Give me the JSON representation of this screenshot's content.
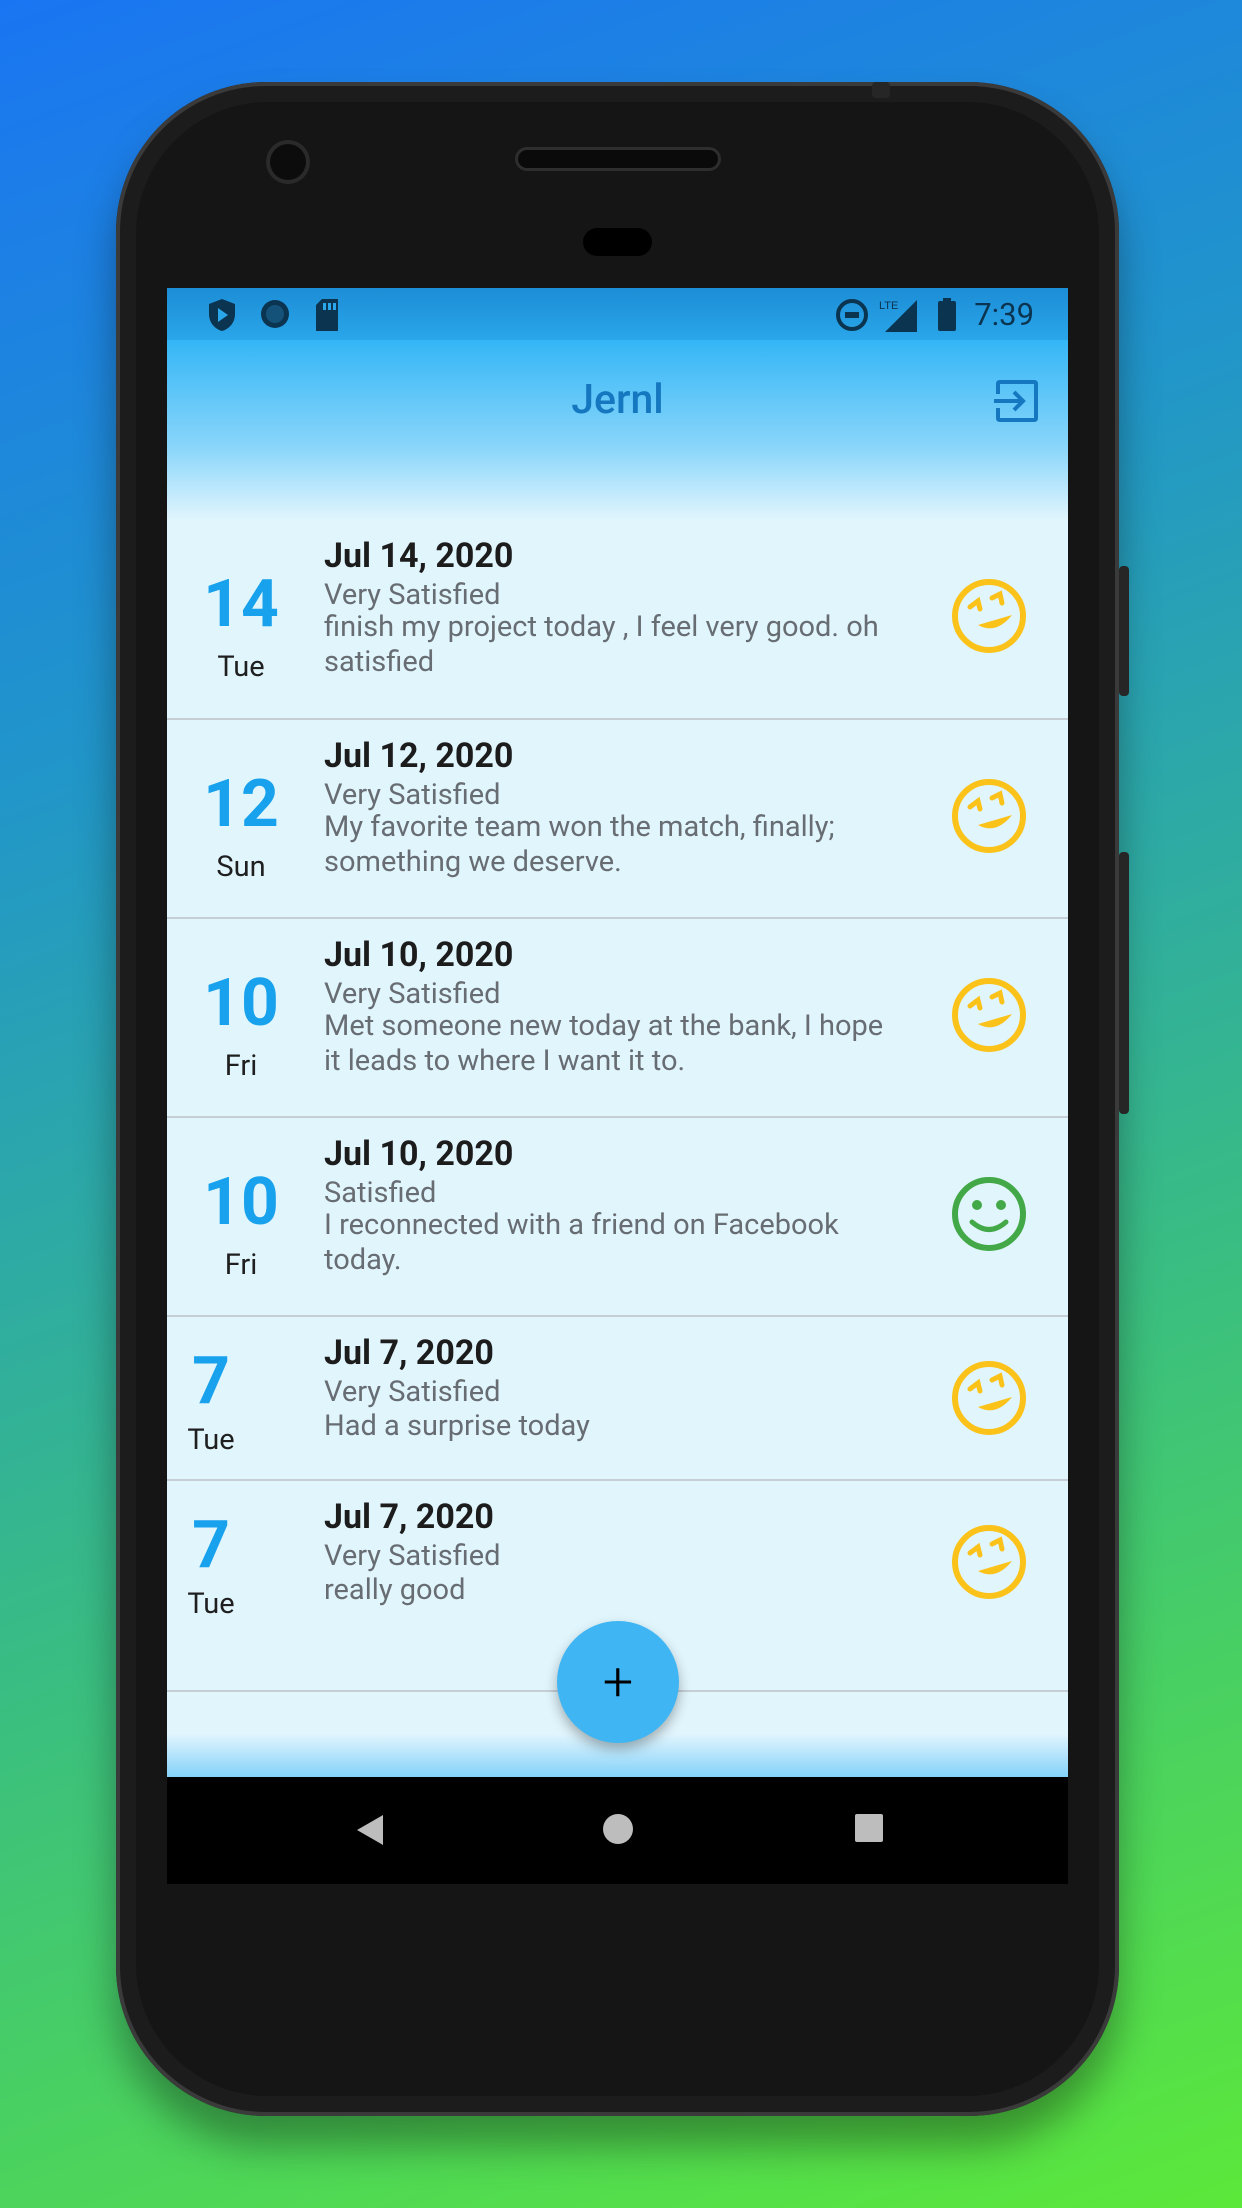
{
  "statusbar": {
    "time": "7:39",
    "network": "LTE"
  },
  "app": {
    "title": "Jernl"
  },
  "entries": [
    {
      "day": "14",
      "weekday": "Tue",
      "date": "Jul 14, 2020",
      "mood": "Very Satisfied",
      "text": "finish my project today , I feel very good. oh satisfied",
      "icon": "very-satisfied-icon"
    },
    {
      "day": "12",
      "weekday": "Sun",
      "date": "Jul 12, 2020",
      "mood": "Very Satisfied",
      "text": "My favorite team won the match, finally; something we deserve.",
      "icon": "very-satisfied-icon"
    },
    {
      "day": "10",
      "weekday": "Fri",
      "date": "Jul 10, 2020",
      "mood": "Very Satisfied",
      "text": "Met someone new today at the bank, I hope it leads to where I want it to.",
      "icon": "very-satisfied-icon"
    },
    {
      "day": "10",
      "weekday": "Fri",
      "date": "Jul 10, 2020",
      "mood": "Satisfied",
      "text": "I reconnected with a friend on Facebook today.",
      "icon": "satisfied-icon"
    },
    {
      "day": "7",
      "weekday": "Tue",
      "date": "Jul 7, 2020",
      "mood": "Very Satisfied",
      "text": "Had a surprise today",
      "icon": "very-satisfied-icon"
    },
    {
      "day": "7",
      "weekday": "Tue",
      "date": "Jul 7, 2020",
      "mood": "Very Satisfied",
      "text": "really good",
      "icon": "very-satisfied-icon"
    }
  ],
  "fab": {
    "label": "+"
  },
  "colors": {
    "accent": "#18a1ec",
    "very_satisfied": "#fbc21a",
    "satisfied": "#43a848",
    "title": "#1577bf"
  }
}
